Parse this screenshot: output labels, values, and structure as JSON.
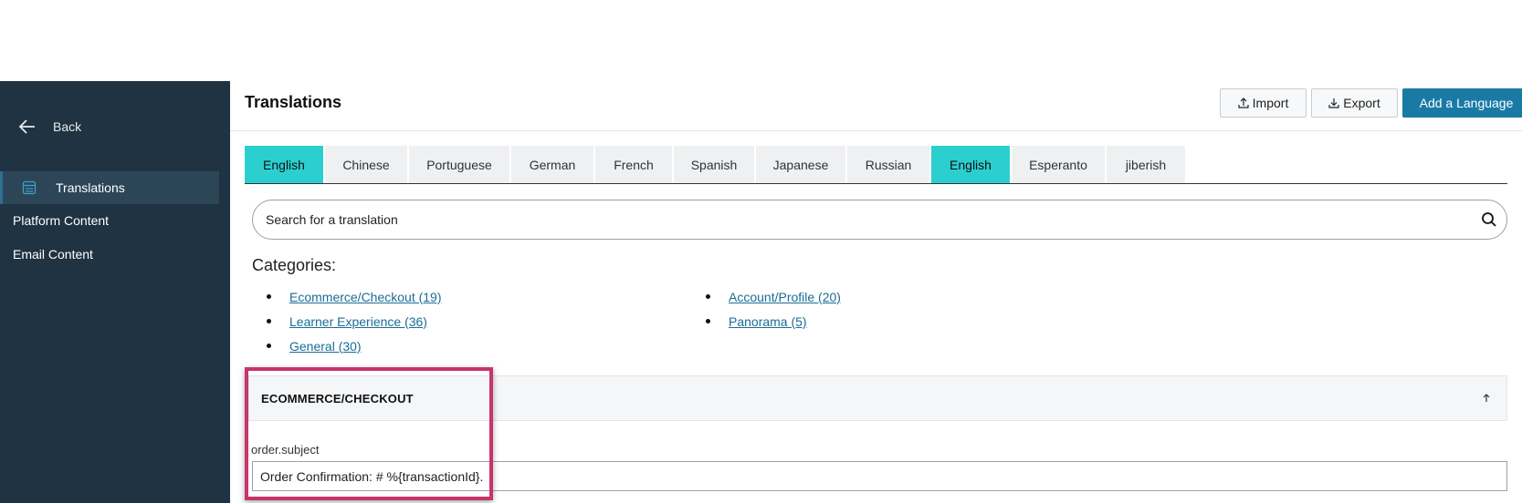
{
  "sidebar": {
    "back_label": "Back",
    "active_item": "Translations",
    "items": [
      "Platform Content",
      "Email Content"
    ]
  },
  "header": {
    "title": "Translations",
    "import_label": "Import",
    "export_label": "Export",
    "add_language_label": "Add a Language"
  },
  "tabs": [
    "English",
    "Chinese",
    "Portuguese",
    "German",
    "French",
    "Spanish",
    "Japanese",
    "Russian",
    "English",
    "Esperanto",
    "jiberish"
  ],
  "active_tabs": [
    0,
    8
  ],
  "search": {
    "placeholder": "Search for a translation",
    "value": ""
  },
  "categories": {
    "heading": "Categories:",
    "left": [
      "Ecommerce/Checkout (19)",
      "Learner Experience (36)",
      "General (30)"
    ],
    "right": [
      "Account/Profile (20)",
      "Panorama (5)"
    ]
  },
  "section": {
    "title": "ECOMMERCE/CHECKOUT"
  },
  "field": {
    "label": "order.subject",
    "value": "Order Confirmation: # %{transactionId}."
  },
  "colors": {
    "sidebar_bg": "#1f3342",
    "tab_active": "#2ccfd0",
    "primary": "#1a7aa6",
    "highlight": "#c7346b"
  }
}
